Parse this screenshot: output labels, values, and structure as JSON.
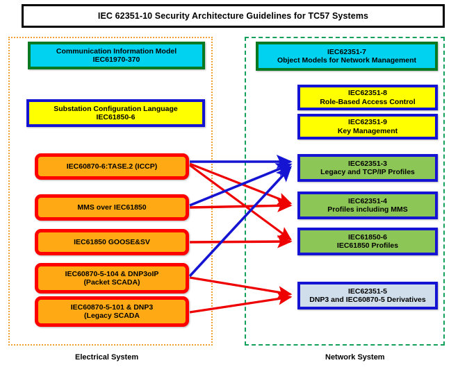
{
  "title": {
    "text": "IEC 62351-10 Security Architecture Guidelines for TC57 Systems"
  },
  "groups": {
    "electrical": {
      "caption": "Electrical System",
      "border_color": "#f0a030",
      "border_style": "dotted"
    },
    "network": {
      "caption": "Network System",
      "border_color": "#13a05a",
      "border_style": "dashed"
    }
  },
  "colors": {
    "cyan_fill": "#00d2f0",
    "green_border": "#0a7a22",
    "yellow_fill": "#ffff00",
    "blue_border": "#1414d2",
    "orange_fill": "#ffaa14",
    "red_border": "#ff0000",
    "green_fill": "#8cc656",
    "lightblue_fill": "#cfdeea",
    "red_arrow": "#ee0000",
    "blue_arrow": "#1414d2"
  },
  "nodes": {
    "cim": {
      "line1": "Communication Information Model",
      "line2": "IEC61970-370"
    },
    "scl": {
      "line1": "Substation Configuration Language",
      "line2": "IEC61850-6"
    },
    "iccp": {
      "line1": "IEC60870-6:TASE.2 (ICCP)",
      "line2": ""
    },
    "mms": {
      "line1": "MMS over IEC61850",
      "line2": ""
    },
    "goose": {
      "line1": "IEC61850 GOOSE&SV",
      "line2": ""
    },
    "sc104": {
      "line1": "IEC60870-5-104 & DNP3oIP",
      "line2": "(Packet SCADA)"
    },
    "sc101": {
      "line1": "IEC60870-5-101 & DNP3",
      "line2": "(Legacy SCADA"
    },
    "p7": {
      "line1": "IEC62351-7",
      "line2": "Object Models for Network Management"
    },
    "p8": {
      "line1": "IEC62351-8",
      "line2": "Role-Based Access Control"
    },
    "p9": {
      "line1": "IEC62351-9",
      "line2": "Key Management"
    },
    "p3": {
      "line1": "IEC62351-3",
      "line2": "Legacy and TCP/IP Profiles"
    },
    "p4": {
      "line1": "IEC62351-4",
      "line2": "Profiles including MMS"
    },
    "p61850": {
      "line1": "IEC61850-6",
      "line2": "IEC61850 Profiles"
    },
    "p5": {
      "line1": "IEC62351-5",
      "line2": "DNP3 and IEC60870-5 Derivatives"
    }
  },
  "connections": [
    {
      "from": "iccp",
      "to": "p3",
      "color": "blue"
    },
    {
      "from": "iccp",
      "to": "p4",
      "color": "red"
    },
    {
      "from": "iccp",
      "to": "p61850",
      "color": "red"
    },
    {
      "from": "mms",
      "to": "p3",
      "color": "blue"
    },
    {
      "from": "mms",
      "to": "p4",
      "color": "red"
    },
    {
      "from": "goose",
      "to": "p61850",
      "color": "red"
    },
    {
      "from": "sc104",
      "to": "p3",
      "color": "blue"
    },
    {
      "from": "sc104",
      "to": "p5",
      "color": "red"
    },
    {
      "from": "sc101",
      "to": "p5",
      "color": "red"
    }
  ]
}
